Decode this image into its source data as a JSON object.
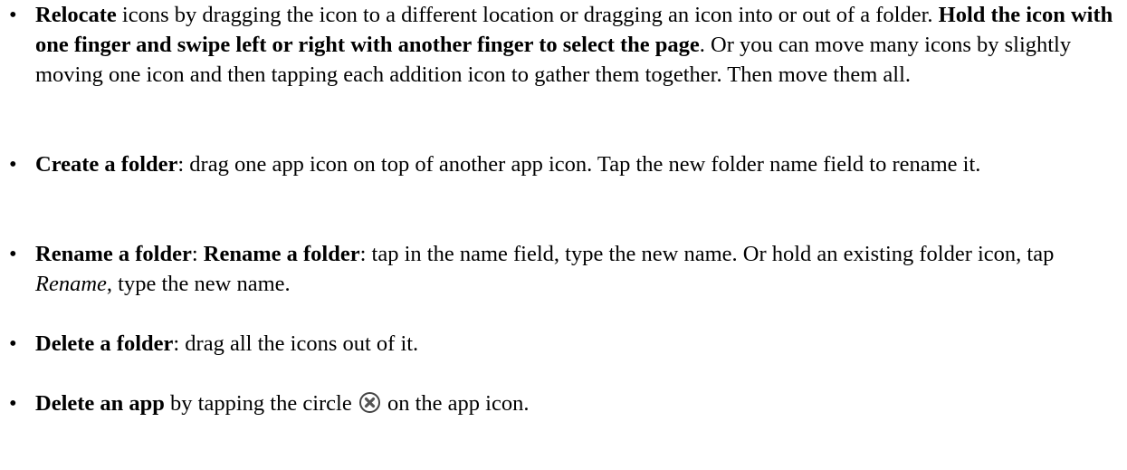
{
  "bullet": "•",
  "items": [
    {
      "term": "Relocate",
      "text1": " icons by dragging the icon to a different location or dragging an icon into or out of a folder. ",
      "bold2": "Hold the icon with one finger and swipe left or right with another finger to select the page",
      "text2": ". Or you can move many icons by slightly moving one icon and then tapping each addition icon to gather them together. Then move them all."
    },
    {
      "term": "Create a folder",
      "text1": ": drag one app icon on top of another app icon. Tap the new folder name field to rename it."
    },
    {
      "term": "Rename a folder",
      "sep": ": ",
      "term2": "Rename a folder",
      "text1": ": tap in the name field, type the new name. Or hold an existing folder icon, tap ",
      "italic": "Rename",
      "text2": ", type the new name."
    },
    {
      "term": "Delete a folder",
      "text1": ": drag all the icons out of it."
    },
    {
      "term": "Delete an app",
      "text1": " by tapping the circle ",
      "icon": "circle-x-icon",
      "text2": " on the app icon."
    }
  ]
}
